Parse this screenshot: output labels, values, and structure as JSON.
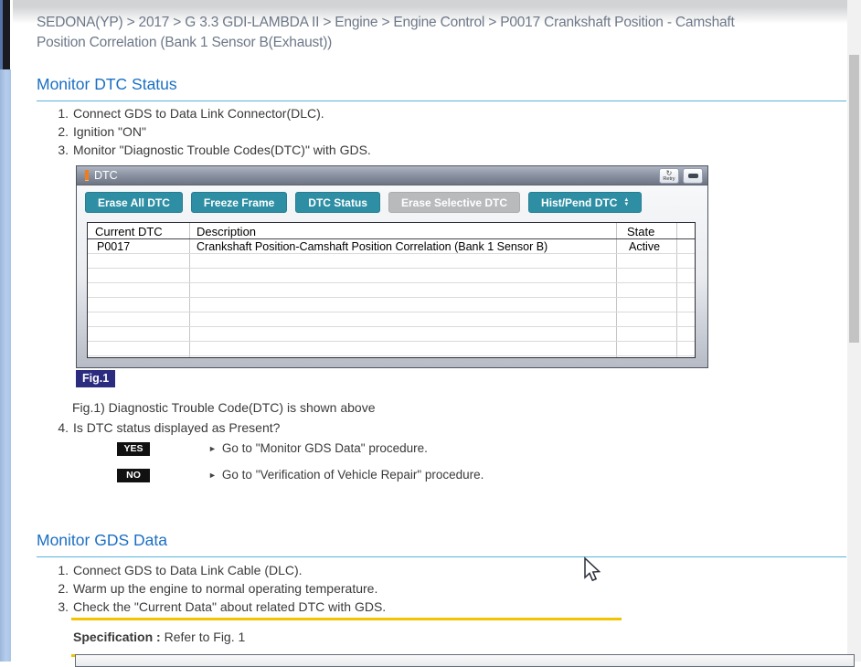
{
  "page": {
    "breadcrumb": "SEDONA(YP) > 2017 > G 3.3 GDI-LAMBDA II > Engine > Engine Control > P0017 Crankshaft Position - Camshaft Position Correlation (Bank 1 Sensor B(Exhaust))"
  },
  "monitor_dtc": {
    "title": "Monitor DTC Status",
    "steps": [
      {
        "num": "1.",
        "text": "Connect GDS to Data Link Connector(DLC)."
      },
      {
        "num": "2.",
        "text": "Ignition \"ON\""
      },
      {
        "num": "3.",
        "text": "Monitor \"Diagnostic Trouble Codes(DTC)\" with GDS."
      }
    ],
    "fig_caption": "Fig.1) Diagnostic Trouble Code(DTC) is shown above",
    "step4": {
      "num": "4.",
      "text": "Is DTC status displayed as Present?"
    },
    "decisions": [
      {
        "label": "YES",
        "action": "Go to \"Monitor GDS Data\" procedure."
      },
      {
        "label": "NO",
        "action": "Go to \"Verification of Vehicle Repair\" procedure."
      }
    ]
  },
  "dtc_dialog": {
    "title": "DTC",
    "retry_icon_label": "Retry",
    "buttons": [
      {
        "label": "Erase All DTC",
        "enabled": true
      },
      {
        "label": "Freeze Frame",
        "enabled": true
      },
      {
        "label": "DTC Status",
        "enabled": true
      },
      {
        "label": "Erase Selective DTC",
        "enabled": false
      },
      {
        "label": "Hist/Pend DTC",
        "enabled": true,
        "has_spinner": true
      }
    ],
    "table": {
      "columns": [
        "Current DTC",
        "Description",
        "State"
      ],
      "row": {
        "dtc": "P0017",
        "description": "Crankshaft Position-Camshaft Position Correlation (Bank 1 Sensor B)",
        "state": "Active"
      }
    },
    "fig_label": "Fig.1"
  },
  "monitor_gds": {
    "title": "Monitor GDS Data",
    "steps": [
      {
        "num": "1.",
        "text": "Connect GDS to Data Link Cable (DLC)."
      },
      {
        "num": "2.",
        "text": "Warm up the engine to normal operating temperature."
      },
      {
        "num": "3.",
        "text": "Check the \"Current Data\" about related DTC with GDS."
      }
    ],
    "spec_label": "Specification :",
    "spec_value": "Refer to Fig. 1"
  },
  "icons": {
    "arrow_bullet": "►",
    "retry_glyph": "↻",
    "spinner_up": "▲",
    "spinner_down": "▼"
  },
  "colors": {
    "accent_blue": "#1b6fc3",
    "button_teal": "#2e8fa4",
    "spec_yellow": "#f2c300",
    "fig_badge_navy": "#2b2b80",
    "decision_badge_black": "#111111",
    "breadcrumb_gray": "#6d7888"
  }
}
